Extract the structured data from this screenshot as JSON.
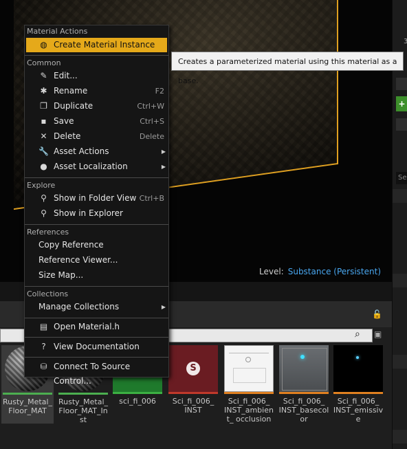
{
  "viewport": {
    "level_label": "Level:",
    "level_value": "Substance (Persistent)"
  },
  "menu": {
    "sections": {
      "material_actions": "Material Actions",
      "common": "Common",
      "explore": "Explore",
      "references": "References",
      "collections": "Collections"
    },
    "items": {
      "create_material_instance": "Create Material Instance",
      "edit": "Edit...",
      "rename": "Rename",
      "rename_sc": "F2",
      "duplicate": "Duplicate",
      "duplicate_sc": "Ctrl+W",
      "save": "Save",
      "save_sc": "Ctrl+S",
      "delete": "Delete",
      "delete_sc": "Delete",
      "asset_actions": "Asset Actions",
      "asset_localization": "Asset Localization",
      "show_folder": "Show in Folder View",
      "show_folder_sc": "Ctrl+B",
      "show_explorer": "Show in Explorer",
      "copy_reference": "Copy Reference",
      "reference_viewer": "Reference Viewer...",
      "size_map": "Size Map...",
      "manage_collections": "Manage Collections",
      "open_material_h": "Open Material.h",
      "view_documentation": "View Documentation",
      "connect_source_control": "Connect To Source Control..."
    }
  },
  "tooltip": {
    "text": "Creates a parameterized material using this material as a base."
  },
  "assets": [
    {
      "name": "Rusty_Metal_ Floor_MAT",
      "bar_color": "#4caf50"
    },
    {
      "name": "Rusty_Metal_ Floor_MAT_Inst",
      "bar_color": "#4caf50"
    },
    {
      "name": "sci_fi_006",
      "bar_color": "#3cb043"
    },
    {
      "name": "Sci_fi_006_ INST",
      "bar_color": "#c0392b"
    },
    {
      "name": "Sci_fi_006_ INST_ambient_ occlusion",
      "bar_color": "#e08020"
    },
    {
      "name": "Sci_fi_006_ INST_basecolor",
      "bar_color": "#e08020"
    },
    {
      "name": "Sci_fi_006_ INST_emissive",
      "bar_color": "#e08020"
    }
  ],
  "right_panel": {
    "num": "3",
    "s_label": "Se"
  }
}
